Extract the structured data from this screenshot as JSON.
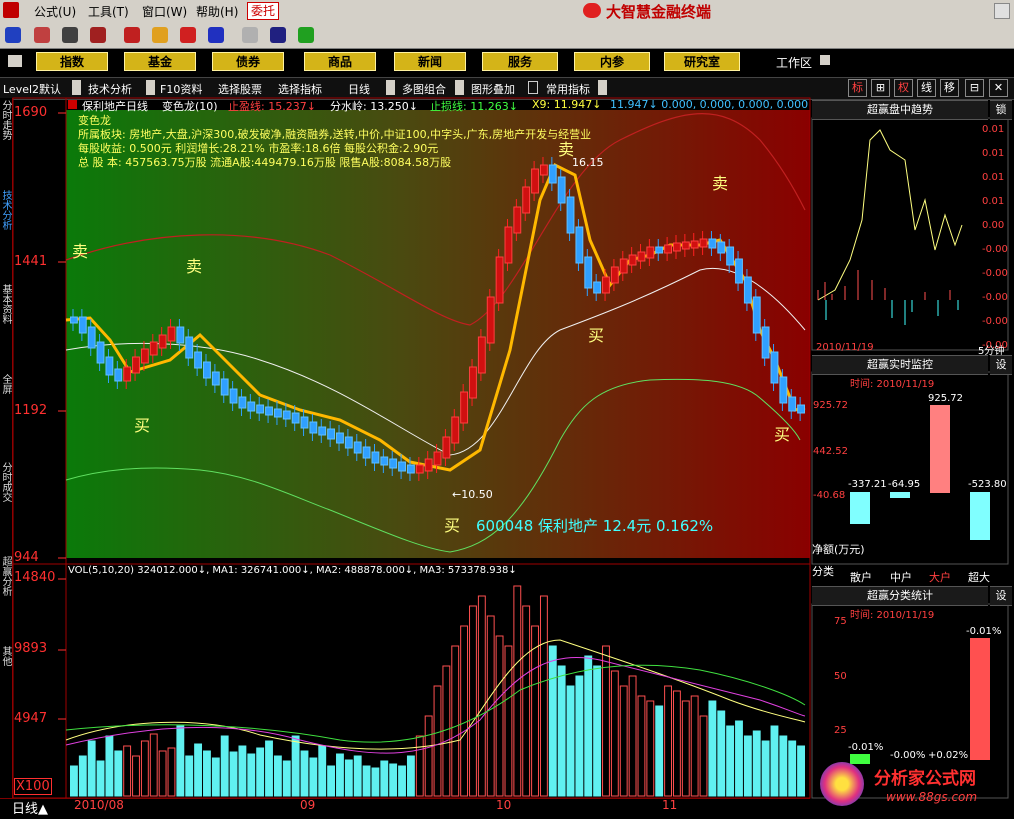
{
  "menu": {
    "items": [
      "公式(U)",
      "工具(T)",
      "窗口(W)",
      "帮助(H)"
    ],
    "active": "委托",
    "app_title": "大智慧金融终端"
  },
  "nav": {
    "buttons": [
      "指数",
      "基金",
      "债券",
      "商品",
      "新闻",
      "服务",
      "内参",
      "研究室"
    ],
    "workspace": "工作区"
  },
  "tabs": {
    "items": [
      "Level2默认",
      "技术分析",
      "F10资料",
      "选择股票",
      "选择指标",
      "日线",
      "多图组合",
      "图形叠加",
      "常用指标"
    ],
    "right": [
      "标",
      "⊞",
      "权",
      "线",
      "移",
      "⊟",
      "✕"
    ]
  },
  "sidebar": [
    "分时走势",
    "技术分析",
    "基本资料",
    "全屏",
    "分时成交",
    "超赢分析",
    "其他"
  ],
  "header": {
    "stock": "保利地产日线",
    "indicator": "变色龙(10)",
    "stop_profit": "止盈线: 15.237↓",
    "watershed": "分水岭: 13.250↓",
    "stop_loss": "止损线: 11.263↓",
    "x9": "X9: 11.947↓",
    "extra": "11.947↓ 0.000, 0.000, 0.000, 0.000"
  },
  "info": {
    "name": "变色龙",
    "sector": "所属板块:  房地产,大盘,沪深300,破发破净,融资融券,送转,中价,中证100,中字头,广东,房地产开发与经营业",
    "eps": "每股收益:  0.500元    利润增长:28.21%    市盈率:18.6倍   每股公积金:2.90元",
    "shares": "总 股 本:  457563.75万股  流通A股:449479.16万股  限售A股:8084.58万股"
  },
  "price_axis": [
    "1690",
    "1441",
    "1192",
    "944"
  ],
  "volume_axis": [
    "14840",
    "9893",
    "4947",
    "X100"
  ],
  "signals": {
    "buy": "买",
    "sell": "卖"
  },
  "annotations": {
    "high": "16.15",
    "low": "←10.50",
    "stock_note": "600048 保利地产 12.4元 0.162%"
  },
  "volume_header": "VOL(5,10,20) 324012.000↓, MA1: 326741.000↓, MA2: 488878.000↓, MA3: 573378.938↓",
  "date_axis": {
    "period": "日线▲",
    "labels": [
      "2010/08",
      "09",
      "10",
      "11"
    ]
  },
  "panels": {
    "trend": {
      "title": "超赢盘中趋势",
      "lock": "锁",
      "date": "2010/11/19",
      "unit": "5分钟",
      "ticks": [
        "0.01",
        "0.01",
        "0.01",
        "0.01",
        "0.00",
        "-0.00",
        "-0.00",
        "-0.00",
        "-0.00",
        "-0.00"
      ]
    },
    "monitor": {
      "title": "超赢实时监控",
      "set": "设",
      "time": "时间: 2010/11/19",
      "axis": [
        "925.72",
        "442.52",
        "-40.68"
      ],
      "top": "925.72",
      "values": [
        "-337.21",
        "-64.95",
        "-523.80"
      ],
      "footer": "净额(万元)",
      "cats_label": "分类",
      "cats": [
        "散户",
        "中户",
        "大户",
        "超大"
      ]
    },
    "stats": {
      "title": "超赢分类统计",
      "set": "设",
      "time": "时间: 2010/11/19",
      "axis": [
        "75",
        "50",
        "25"
      ],
      "top": "-0.01%",
      "values": [
        "-0.01%",
        "-0.00%",
        "+0.02%"
      ]
    }
  },
  "watermark": {
    "name": "分析家公式网",
    "url": "www.88gs.com"
  }
}
